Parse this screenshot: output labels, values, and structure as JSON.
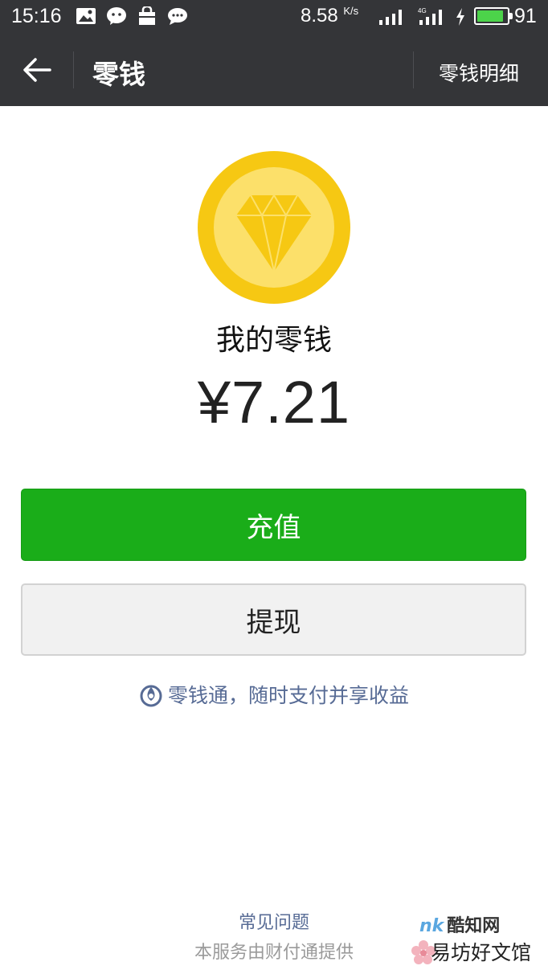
{
  "status_bar": {
    "time": "15:16",
    "net_speed": "8.58",
    "net_speed_unit": "K/s",
    "network_type": "4G",
    "battery_level": 91,
    "battery_pct": "91",
    "icons": [
      "image-icon",
      "wechat-icon",
      "bag-icon",
      "chat-bubble-icon",
      "signal-icon",
      "signal-4g-icon",
      "charging-icon",
      "battery-icon"
    ],
    "battery_color": "#4cd34a"
  },
  "title_bar": {
    "back_icon": "arrow-left-icon",
    "title": "零钱",
    "detail_link": "零钱明细",
    "bg_color": "#343538"
  },
  "wallet": {
    "icon": "diamond-coin-icon",
    "label": "我的零钱",
    "balance": "¥7.21"
  },
  "actions": {
    "recharge_label": "充值",
    "withdraw_label": "提现",
    "primary_color": "#1aad19"
  },
  "promo": {
    "icon": "licaitong-icon",
    "text": "零钱通，随时支付并享收益",
    "link_color": "#576b95"
  },
  "footer": {
    "faq_label": "常见问题",
    "service_note": "本服务由财付通提供"
  },
  "watermark": {
    "brand_mark": "nk",
    "brand_top": "酷知网",
    "brand_bottom": "易坊好文馆"
  }
}
